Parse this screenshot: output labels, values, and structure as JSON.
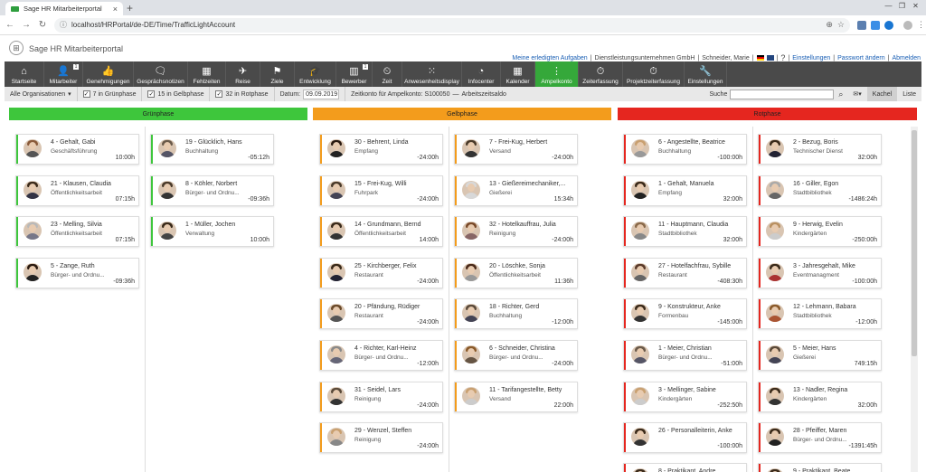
{
  "browser": {
    "tab_title": "Sage HR Mitarbeiterportal",
    "url": "localhost/HRPortal/de-DE/Time/TrafficLightAccount"
  },
  "app": {
    "title": "Sage HR Mitarbeiterportal",
    "tasks_link": "Meine erledigten Aufgaben",
    "company": "Dienstleistungsunternehmen GmbH",
    "user": "Schneider, Marie",
    "settings_link": "Einstellungen",
    "password_link": "Passwort ändern",
    "logout_link": "Abmelden"
  },
  "toolbar": [
    {
      "label": "Startseite",
      "icon": "home-icon",
      "glyph": "⌂",
      "w": 44
    },
    {
      "label": "Mitarbeiter",
      "icon": "user-icon",
      "glyph": "👤",
      "w": 43,
      "badge": "1"
    },
    {
      "label": "Genehmigungen",
      "icon": "thumbs-up-icon",
      "glyph": "👍",
      "w": 56
    },
    {
      "label": "Gesprächsnotizen",
      "icon": "chat-icon",
      "glyph": "🗨",
      "w": 60
    },
    {
      "label": "Fehlzeiten",
      "icon": "calendar-icon",
      "glyph": "▦",
      "w": 42
    },
    {
      "label": "Reise",
      "icon": "plane-icon",
      "glyph": "✈",
      "w": 38
    },
    {
      "label": "Ziele",
      "icon": "flag-icon",
      "glyph": "⚑",
      "w": 38
    },
    {
      "label": "Entwicklung",
      "icon": "graduation-icon",
      "glyph": "🎓",
      "w": 46
    },
    {
      "label": "Bewerber",
      "icon": "books-icon",
      "glyph": "▥",
      "w": 40,
      "badge": "1"
    },
    {
      "label": "Zeit",
      "icon": "clock-calendar-icon",
      "glyph": "⏲",
      "w": 33
    },
    {
      "label": "Anwesenheitsdisplay",
      "icon": "grid-icon",
      "glyph": "⁙",
      "w": 66
    },
    {
      "label": "Infocenter",
      "icon": "chart-icon",
      "glyph": "◔",
      "w": 43
    },
    {
      "label": "Kalender",
      "icon": "calendar-grid-icon",
      "glyph": "▦",
      "w": 38
    },
    {
      "label": "Ampelkonto",
      "icon": "traffic-light-icon",
      "glyph": "⋮",
      "w": 48,
      "active": true
    },
    {
      "label": "Zeiterfassung",
      "icon": "clock-icon",
      "glyph": "⏱",
      "w": 49
    },
    {
      "label": "Projektzeiterfassung",
      "icon": "project-clock-icon",
      "glyph": "⏱",
      "w": 68
    },
    {
      "label": "Einstellungen",
      "icon": "wrench-icon",
      "glyph": "🔧",
      "w": 47
    }
  ],
  "filters": {
    "org": "Alle Organisationen",
    "green": "7 in Grünphase",
    "yellow": "15 in Gelbphase",
    "red": "32 in Rotphase",
    "date_label": "Datum:",
    "date": "09.09.2019",
    "account": "Zeitkonto für Ampelkonto: S100050",
    "dash": "—",
    "balance": "Arbeitszeitsaldo",
    "search_label": "Suche",
    "view_tiles": "Kachel",
    "view_list": "Liste"
  },
  "phases": {
    "green": "Grünphase",
    "yellow": "Gelbphase",
    "red": "Rotphase"
  },
  "colors": {
    "green": "#3ec63c",
    "yellow": "#f39c1c",
    "red": "#e5261f",
    "toolbar": "#4a4a4a",
    "active": "#35a83a"
  },
  "cards": {
    "green": [
      [
        {
          "name": "4 - Gehalt, Gabi",
          "dept": "Geschäftsführung",
          "hours": "10:00h",
          "hair": "#8a5a3a",
          "body": "#555"
        },
        {
          "name": "21 - Klausen, Claudia",
          "dept": "Öffentlichkeitsarbeit",
          "hours": "07:15h",
          "hair": "#3a2a1a",
          "body": "#334"
        },
        {
          "name": "23 - Melling, Silvia",
          "dept": "Öffentlichkeitsarbeit",
          "hours": "07:15h",
          "hair": "#b9b9b9",
          "body": "#778"
        },
        {
          "name": "5 - Zange, Ruth",
          "dept": "Bürger- und Ordnu...",
          "hours": "-09:36h",
          "hair": "#2a1a10",
          "body": "#222"
        }
      ],
      [
        {
          "name": "19 - Glücklich, Hans",
          "dept": "Buchhaltung",
          "hours": "-05:12h",
          "hair": "#6a5a4a",
          "body": "#556"
        },
        {
          "name": "8 - Köhler, Norbert",
          "dept": "Bürger- und Ordnu...",
          "hours": "-09:36h",
          "hair": "#4a3a2a",
          "body": "#333"
        },
        {
          "name": "1 - Müller, Jochen",
          "dept": "Verwaltung",
          "hours": "10:00h",
          "hair": "#3a2a1a",
          "body": "#444"
        }
      ]
    ],
    "yellow": [
      [
        {
          "name": "30 - Behrent, Linda",
          "dept": "Empfang",
          "hours": "-24:00h",
          "hair": "#2a1a10",
          "body": "#222"
        },
        {
          "name": "15 - Frei-Kug, Willi",
          "dept": "Fuhrpark",
          "hours": "-24:00h",
          "hair": "#4a3a2a",
          "body": "#445"
        },
        {
          "name": "14 - Grundmann, Bernd",
          "dept": "Öffentlichkeitsarbeit",
          "hours": "14:00h",
          "hair": "#3a2a1a",
          "body": "#333"
        },
        {
          "name": "25 - Kirchberger, Felix",
          "dept": "Restaurant",
          "hours": "-24:00h",
          "hair": "#3a2a1a",
          "body": "#223"
        },
        {
          "name": "20 - Pfändung, Rüdiger",
          "dept": "Restaurant",
          "hours": "-24:00h",
          "hair": "#6a4a2a",
          "body": "#555"
        },
        {
          "name": "4 - Richter, Karl-Heinz",
          "dept": "Bürger- und Ordnu...",
          "hours": "-12:00h",
          "hair": "#8a8a8a",
          "body": "#667"
        },
        {
          "name": "31 - Seidel, Lars",
          "dept": "Reinigung",
          "hours": "-24:00h",
          "hair": "#5a4a3a",
          "body": "#333"
        },
        {
          "name": "29 - Wenzel, Steffen",
          "dept": "Reinigung",
          "hours": "-24:00h",
          "hair": "#c9a070",
          "body": "#888"
        }
      ],
      [
        {
          "name": "7 - Frei-Kug, Herbert",
          "dept": "Versand",
          "hours": "-24:00h",
          "hair": "#4a3a2a",
          "body": "#333"
        },
        {
          "name": "13 - Gießereimechaniker,...",
          "dept": "Gießerei",
          "hours": "15:34h",
          "hair": "#d8d8d8",
          "body": "#d8d8d8"
        },
        {
          "name": "32 - Hotelkauffrau, Julia",
          "dept": "Reinigung",
          "hours": "-24:00h",
          "hair": "#7a4a2a",
          "body": "#866"
        },
        {
          "name": "20 - Löschke, Sonja",
          "dept": "Öffentlichkeitsarbeit",
          "hours": "11:36h",
          "hair": "#4a2a1a",
          "body": "#999"
        },
        {
          "name": "18 - Richter, Gerd",
          "dept": "Buchhaltung",
          "hours": "-12:00h",
          "hair": "#5a4a3a",
          "body": "#445"
        },
        {
          "name": "6 - Schneider, Christina",
          "dept": "Bürger- und Ordnu...",
          "hours": "-24:00h",
          "hair": "#8a5a2a",
          "body": "#654"
        },
        {
          "name": "11 - Tarifangestellte, Betty",
          "dept": "Versand",
          "hours": "22:00h",
          "hair": "#c9a070",
          "body": "#ccc"
        }
      ]
    ],
    "red": [
      [
        {
          "name": "6 - Angestellte, Beatrice",
          "dept": "Buchhaltung",
          "hours": "-100:00h",
          "hair": "#c9a070",
          "body": "#999"
        },
        {
          "name": "1 - Gehalt, Manuela",
          "dept": "Empfang",
          "hours": "32:00h",
          "hair": "#3a2a1a",
          "body": "#222"
        },
        {
          "name": "11 - Hauptmann, Claudia",
          "dept": "Stadtbibliothek",
          "hours": "32:00h",
          "hair": "#8a6a4a",
          "body": "#888"
        },
        {
          "name": "27 - Hotelfachfrau, Sybille",
          "dept": "Restaurant",
          "hours": "-408:30h",
          "hair": "#5a3a2a",
          "body": "#666"
        },
        {
          "name": "9 - Konstrukteur, Anke",
          "dept": "Formenbau",
          "hours": "-145:00h",
          "hair": "#3a2a1a",
          "body": "#333"
        },
        {
          "name": "1 - Meier, Christian",
          "dept": "Bürger- und Ordnu...",
          "hours": "-51:00h",
          "hair": "#6a5a4a",
          "body": "#556"
        },
        {
          "name": "3 - Mellinger, Sabine",
          "dept": "Kindergärten",
          "hours": "-252:50h",
          "hair": "#c9a070",
          "body": "#ccc"
        },
        {
          "name": "26 - Personalleiterin, Anke",
          "dept": "",
          "hours": "-100:00h",
          "hair": "#3a2a1a",
          "body": "#333"
        }
      ],
      [
        {
          "name": "2 - Bezug, Boris",
          "dept": "Technischer Dienst",
          "hours": "32:00h",
          "hair": "#3a2a1a",
          "body": "#223"
        },
        {
          "name": "16 - Giller, Egon",
          "dept": "Stadtbibliothek",
          "hours": "-1486:24h",
          "hair": "#aaa",
          "body": "#666"
        },
        {
          "name": "9 - Herwig, Evelin",
          "dept": "Kindergärten",
          "hours": "-250:00h",
          "hair": "#b99060",
          "body": "#ccc"
        },
        {
          "name": "3 - Jahresgehalt, Mike",
          "dept": "Eventmanagment",
          "hours": "-100:00h",
          "hair": "#3a2a1a",
          "body": "#a33"
        },
        {
          "name": "12 - Lehmann, Babara",
          "dept": "Stadtbibliothek",
          "hours": "-12:00h",
          "hair": "#8a5a2a",
          "body": "#a53"
        },
        {
          "name": "5 - Meier, Hans",
          "dept": "Gießerei",
          "hours": "749:15h",
          "hair": "#5a4a3a",
          "body": "#445"
        },
        {
          "name": "13 - Nadler, Regina",
          "dept": "Kindergärten",
          "hours": "32:00h",
          "hair": "#3a2a1a",
          "body": "#333"
        },
        {
          "name": "28 - Pfeiffer, Maren",
          "dept": "Bürger- und Ordnu...",
          "hours": "-1391:45h",
          "hair": "#3a2a1a",
          "body": "#222"
        }
      ]
    ],
    "partial": [
      {
        "name": "8 - Praktikant, Andre"
      },
      {
        "name": "9 - Praktikant, Beate"
      }
    ]
  }
}
